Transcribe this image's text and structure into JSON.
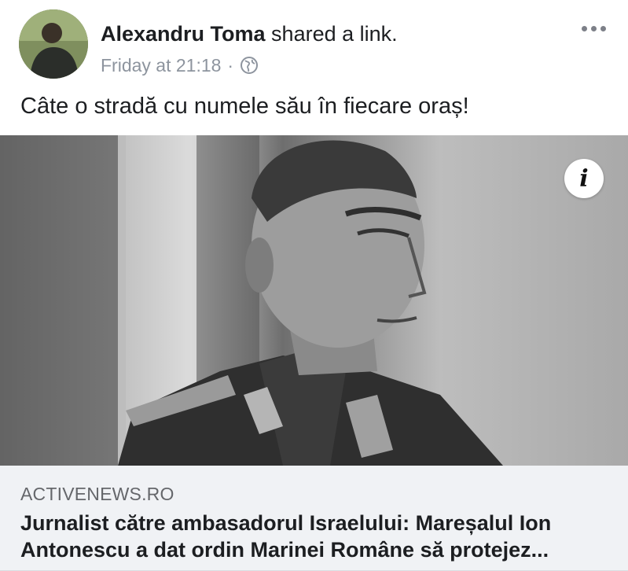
{
  "post": {
    "author_name": "Alexandru Toma",
    "author_action": " shared a link.",
    "timestamp": "Friday at 21:18",
    "separator": "·",
    "privacy_icon": "globe-icon",
    "more_icon": "more-options-icon",
    "text": "Câte o stradă cu numele său în fiecare oraș!"
  },
  "link": {
    "info_label": "i",
    "domain": "ACTIVENEWS.RO",
    "title": "Jurnalist către ambasadorul Israelului: Mareșalul Ion Antonescu a dat ordin Marinei Române să protejez..."
  },
  "colors": {
    "secondary_text": "#8d949e",
    "footer_bg": "#f0f2f5",
    "primary_text": "#1c1e21"
  }
}
